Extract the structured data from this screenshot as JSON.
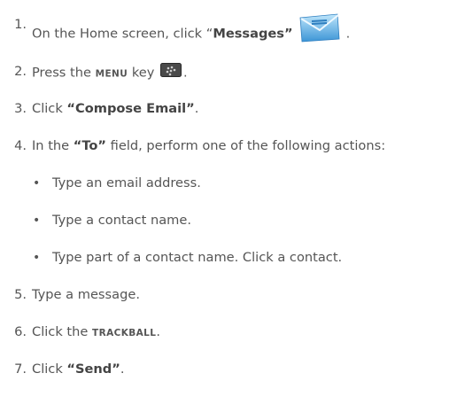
{
  "steps": [
    {
      "num": "1.",
      "pre": "On the Home screen, click “",
      "bold": "Messages”",
      "post": "."
    },
    {
      "num": "2.",
      "pre": "Press the ",
      "key": "MENU",
      "mid": " key",
      "post": "."
    },
    {
      "num": "3.",
      "pre": "Click ",
      "bold": "“Compose Email”",
      "post": "."
    },
    {
      "num": "4.",
      "pre": "In the ",
      "bold": "“To”",
      "post": " field, perform one of the following actions:"
    },
    {
      "num": "5.",
      "text": "Type a message."
    },
    {
      "num": "6.",
      "pre": "Click the ",
      "key": "TRACKBALL",
      "post": "."
    },
    {
      "num": "7.",
      "pre": "Click ",
      "bold": "“Send”",
      "post": "."
    }
  ],
  "bullets": [
    "Type an email address.",
    "Type a contact name.",
    "Type part of a contact name. Click a contact."
  ],
  "icons": {
    "messages": "envelope-icon",
    "menu_key": "blackberry-menu-key-icon"
  },
  "colors": {
    "text": "#555555",
    "envelope_blue": "#4aa3df",
    "key_dark": "#4a4a4a"
  }
}
